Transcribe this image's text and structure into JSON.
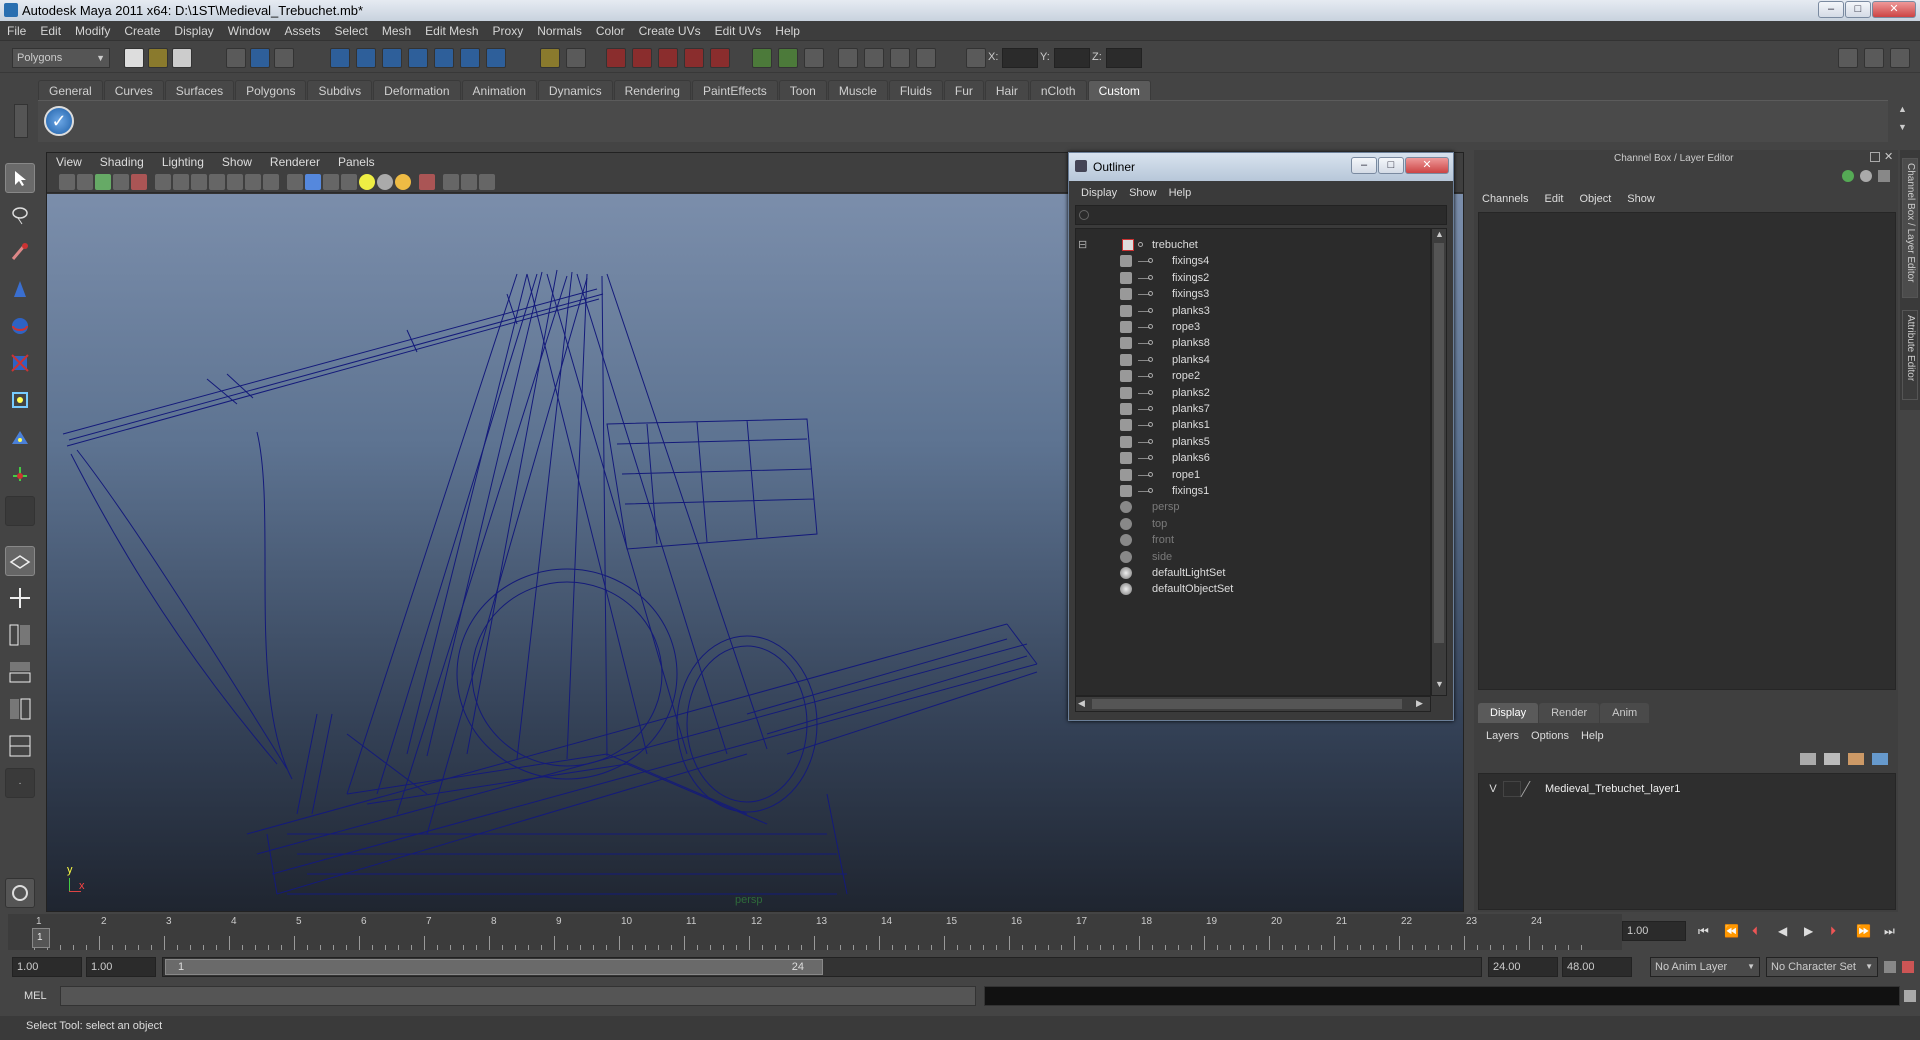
{
  "window": {
    "title": "Autodesk Maya 2011 x64: D:\\1ST\\Medieval_Trebuchet.mb*"
  },
  "menubar": [
    "File",
    "Edit",
    "Modify",
    "Create",
    "Display",
    "Window",
    "Assets",
    "Select",
    "Mesh",
    "Edit Mesh",
    "Proxy",
    "Normals",
    "Color",
    "Create UVs",
    "Edit UVs",
    "Help"
  ],
  "statusline": {
    "mode_selector": "Polygons",
    "x_label": "X:",
    "y_label": "Y:",
    "z_label": "Z:"
  },
  "shelf_tabs": [
    "General",
    "Curves",
    "Surfaces",
    "Polygons",
    "Subdivs",
    "Deformation",
    "Animation",
    "Dynamics",
    "Rendering",
    "PaintEffects",
    "Toon",
    "Muscle",
    "Fluids",
    "Fur",
    "Hair",
    "nCloth",
    "Custom"
  ],
  "shelf_active_tab": "Custom",
  "viewport": {
    "menu": [
      "View",
      "Shading",
      "Lighting",
      "Show",
      "Renderer",
      "Panels"
    ],
    "camera_label": "persp",
    "axis_y": "y",
    "axis_x": "x",
    "wire_color": "#141a7a"
  },
  "outliner": {
    "title": "Outliner",
    "menu": [
      "Display",
      "Show",
      "Help"
    ],
    "items": [
      {
        "label": "trebuchet",
        "level": 0,
        "kind": "group",
        "dim": false
      },
      {
        "label": "fixings4",
        "level": 1,
        "kind": "mesh",
        "dim": false
      },
      {
        "label": "fixings2",
        "level": 1,
        "kind": "mesh",
        "dim": false
      },
      {
        "label": "fixings3",
        "level": 1,
        "kind": "mesh",
        "dim": false
      },
      {
        "label": "planks3",
        "level": 1,
        "kind": "mesh",
        "dim": false
      },
      {
        "label": "rope3",
        "level": 1,
        "kind": "mesh",
        "dim": false
      },
      {
        "label": "planks8",
        "level": 1,
        "kind": "mesh",
        "dim": false
      },
      {
        "label": "planks4",
        "level": 1,
        "kind": "mesh",
        "dim": false
      },
      {
        "label": "rope2",
        "level": 1,
        "kind": "mesh",
        "dim": false
      },
      {
        "label": "planks2",
        "level": 1,
        "kind": "mesh",
        "dim": false
      },
      {
        "label": "planks7",
        "level": 1,
        "kind": "mesh",
        "dim": false
      },
      {
        "label": "planks1",
        "level": 1,
        "kind": "mesh",
        "dim": false
      },
      {
        "label": "planks5",
        "level": 1,
        "kind": "mesh",
        "dim": false
      },
      {
        "label": "planks6",
        "level": 1,
        "kind": "mesh",
        "dim": false
      },
      {
        "label": "rope1",
        "level": 1,
        "kind": "mesh",
        "dim": false
      },
      {
        "label": "fixings1",
        "level": 1,
        "kind": "mesh",
        "dim": false
      },
      {
        "label": "persp",
        "level": 0,
        "kind": "camera",
        "dim": true
      },
      {
        "label": "top",
        "level": 0,
        "kind": "camera",
        "dim": true
      },
      {
        "label": "front",
        "level": 0,
        "kind": "camera",
        "dim": true
      },
      {
        "label": "side",
        "level": 0,
        "kind": "camera",
        "dim": true
      },
      {
        "label": "defaultLightSet",
        "level": 0,
        "kind": "set",
        "dim": false
      },
      {
        "label": "defaultObjectSet",
        "level": 0,
        "kind": "set",
        "dim": false
      }
    ]
  },
  "channelbox": {
    "title": "Channel Box / Layer Editor",
    "menu": [
      "Channels",
      "Edit",
      "Object",
      "Show"
    ],
    "layer_tabs": [
      "Display",
      "Render",
      "Anim"
    ],
    "layer_tab_active": "Display",
    "layer_menu": [
      "Layers",
      "Options",
      "Help"
    ],
    "layer": {
      "visible": "V",
      "name": "Medieval_Trebuchet_layer1"
    },
    "side_tabs": [
      "Channel Box / Layer Editor",
      "Attribute Editor"
    ]
  },
  "timeline": {
    "ticks": [
      "1",
      "2",
      "3",
      "4",
      "5",
      "6",
      "7",
      "8",
      "9",
      "10",
      "11",
      "12",
      "13",
      "14",
      "15",
      "16",
      "17",
      "18",
      "19",
      "20",
      "21",
      "22",
      "23",
      "24"
    ],
    "current_frame_marker": "1",
    "current_time": "1.00"
  },
  "range": {
    "start_time": "1.00",
    "playback_start": "1.00",
    "range_start_label": "1",
    "range_end_label": "24",
    "playback_end": "24.00",
    "end_time": "48.00",
    "anim_layer": "No Anim Layer",
    "character_set": "No Character Set"
  },
  "command": {
    "lang_label": "MEL"
  },
  "helpline": {
    "text": "Select Tool: select an object"
  }
}
